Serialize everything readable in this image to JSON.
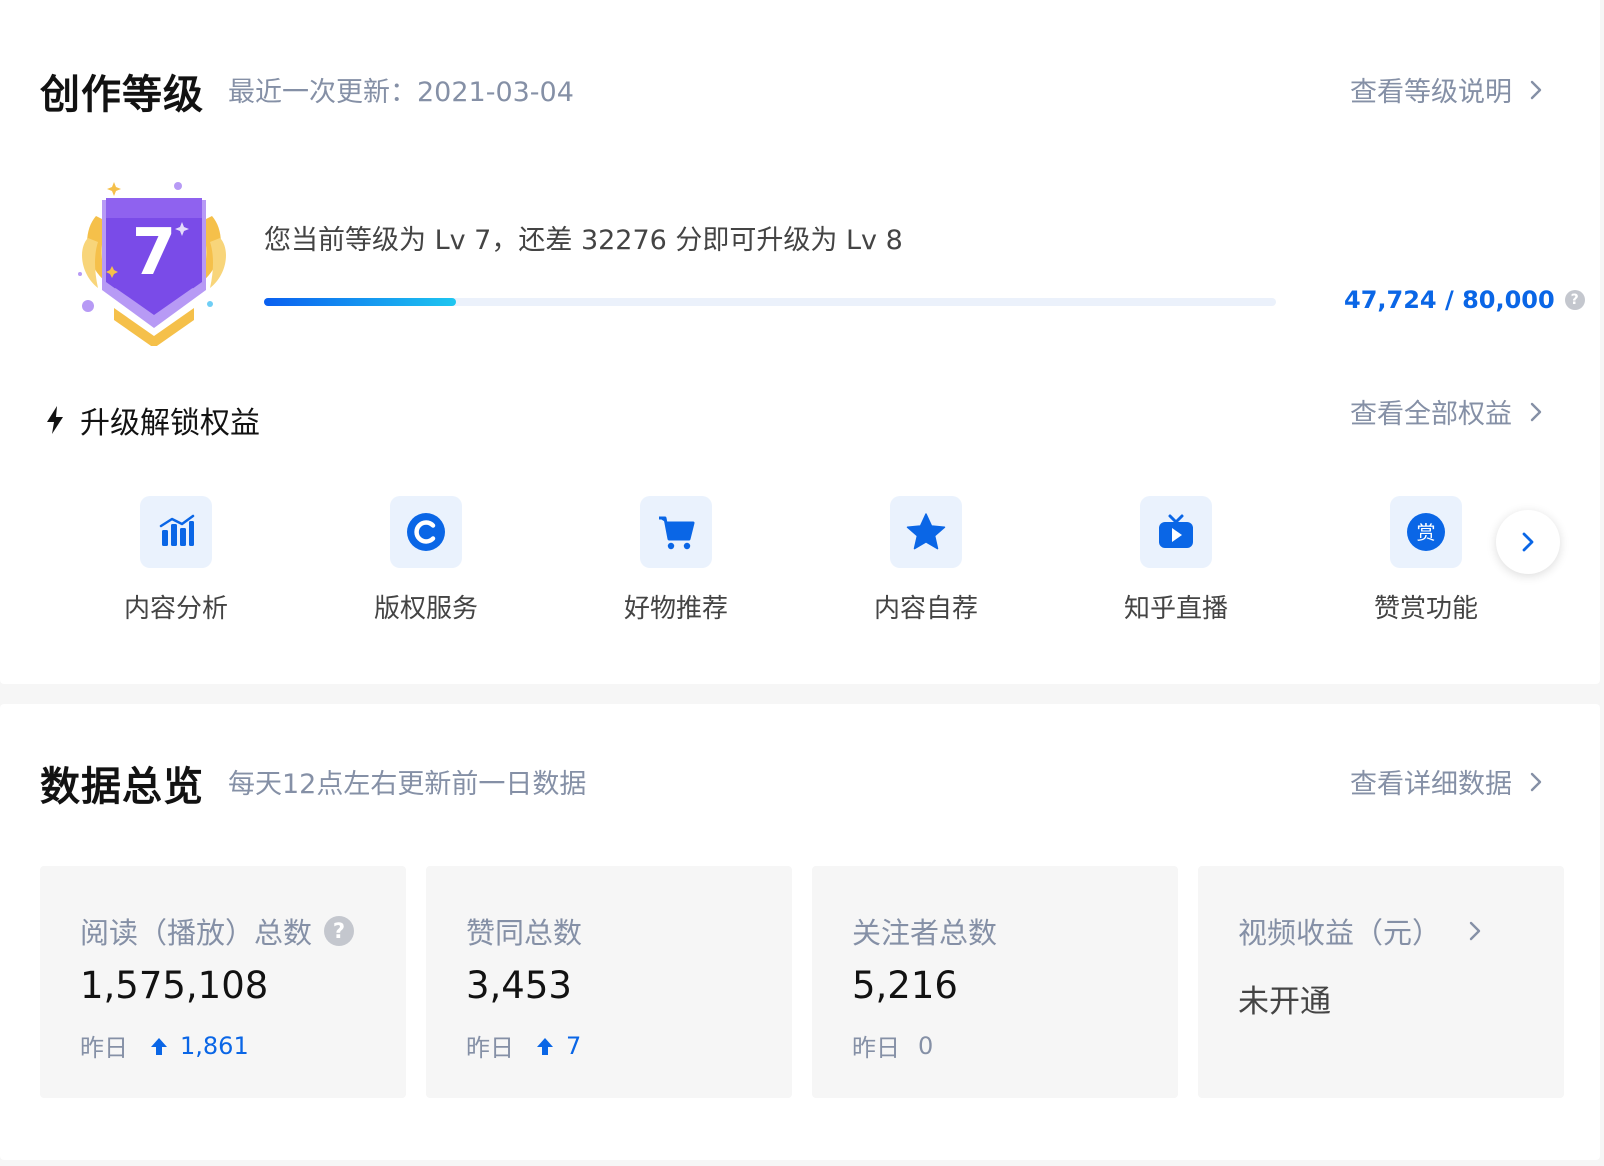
{
  "level": {
    "title": "创作等级",
    "updated": "最近一次更新：2021-03-04",
    "link": "查看等级说明",
    "badge_number": "7",
    "description": "您当前等级为 Lv 7，还差 32276 分即可升级为 Lv 8",
    "score": "47,724 / 80,000",
    "progress_fraction": 0.19,
    "help_icon": "question-icon",
    "benefits_title": "升级解锁权益",
    "benefits_link": "查看全部权益",
    "benefits": [
      {
        "label": "内容分析",
        "icon": "chart-bar-icon"
      },
      {
        "label": "版权服务",
        "icon": "copyright-icon"
      },
      {
        "label": "好物推荐",
        "icon": "cart-icon"
      },
      {
        "label": "内容自荐",
        "icon": "star-icon"
      },
      {
        "label": "知乎直播",
        "icon": "tv-play-icon"
      },
      {
        "label": "赞赏功能",
        "icon": "reward-icon",
        "glyph": "赏"
      }
    ]
  },
  "overview": {
    "title": "数据总览",
    "subtitle": "每天12点左右更新前一日数据",
    "link": "查看详细数据",
    "stats": [
      {
        "label": "阅读（播放）总数",
        "value": "1,575,108",
        "delta_label": "昨日",
        "delta": "1,861"
      },
      {
        "label": "赞同总数",
        "value": "3,453",
        "delta_label": "昨日",
        "delta": "7"
      },
      {
        "label": "关注者总数",
        "value": "5,216",
        "delta_label": "昨日",
        "delta": "0"
      },
      {
        "label": "视频收益（元）",
        "status": "未开通"
      }
    ]
  },
  "colors": {
    "accent": "#0a66e6",
    "muted_text": "#8590a6",
    "badge_purple": "#7a4be8",
    "badge_gold": "#f5c04a",
    "icon_bg": "#eaf2fd"
  }
}
